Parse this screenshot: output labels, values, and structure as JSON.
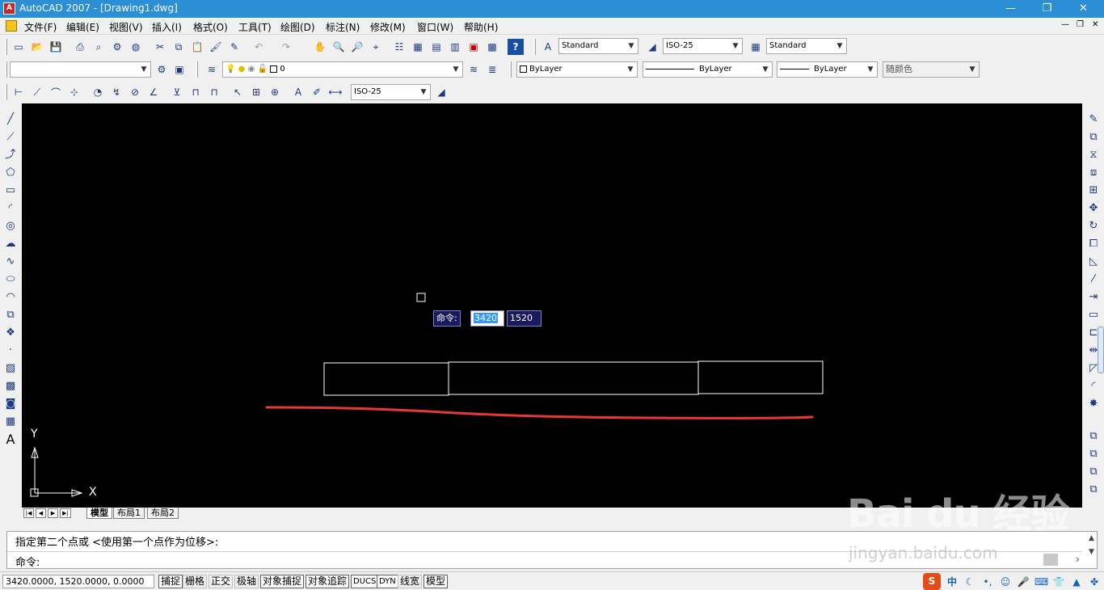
{
  "window": {
    "title": "AutoCAD 2007 - [Drawing1.dwg]",
    "minimize": "—",
    "maximize": "❐",
    "close": "✕",
    "app_icon": "A"
  },
  "menu": {
    "items": [
      "文件(F)",
      "编辑(E)",
      "视图(V)",
      "插入(I)",
      "格式(O)",
      "工具(T)",
      "绘图(D)",
      "标注(N)",
      "修改(M)",
      "窗口(W)",
      "帮助(H)"
    ],
    "doc_controls": [
      "—",
      "❐",
      "✕"
    ]
  },
  "styles_toolbar": {
    "text_style": "Standard",
    "dim_style": "ISO-25",
    "table_style": "Standard"
  },
  "layers_toolbar": {
    "workspace": "",
    "layer": "0"
  },
  "properties_toolbar": {
    "color": "ByLayer",
    "linetype": "ByLayer",
    "lineweight": "ByLayer",
    "plot_style": "随颜色"
  },
  "dimension_toolbar": {
    "dim_style": "ISO-25"
  },
  "canvas": {
    "dynamic_input_label": "命令:",
    "dynamic_input_x": "3420",
    "dynamic_input_y": "1520",
    "ucs_x_label": "X",
    "ucs_y_label": "Y",
    "stroke_color": "#ffffff",
    "annotation_color": "#e53935"
  },
  "layout_tabs": {
    "tabs": [
      "模型",
      "布局1",
      "布局2"
    ],
    "nav": [
      "|◀",
      "◀",
      "▶",
      "▶|"
    ]
  },
  "command": {
    "history_line": "指定第二个点或 <使用第一个点作为位移>:",
    "prompt_line": "命令:"
  },
  "status": {
    "coordinates": "3420.0000, 1520.0000, 0.0000",
    "toggles": [
      "捕捉",
      "栅格",
      "正交",
      "极轴",
      "对象捕捉",
      "对象追踪",
      "DUCS",
      "DYN",
      "线宽",
      "模型"
    ]
  },
  "watermark": {
    "brand": "Bai du 经验",
    "url": "jingyan.baidu.com"
  },
  "tray": {
    "ime": "中"
  }
}
